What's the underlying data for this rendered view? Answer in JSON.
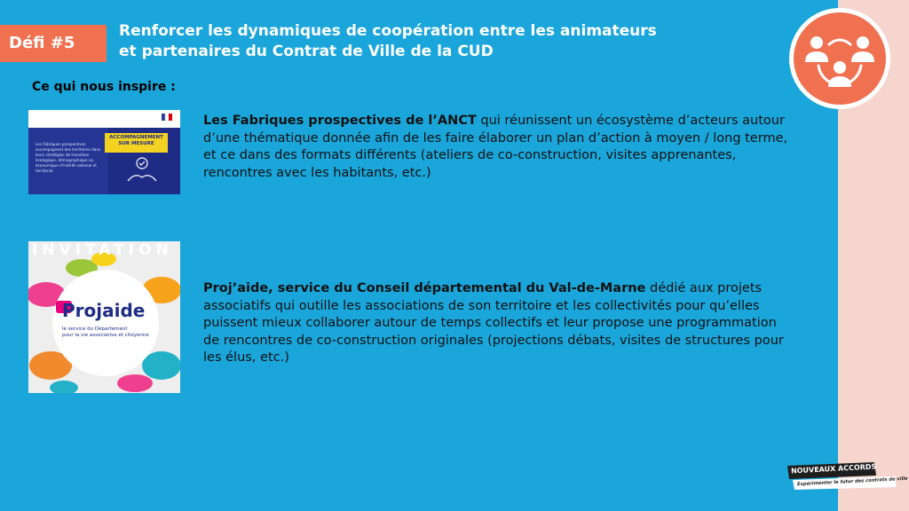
{
  "header": {
    "badge": "Défi #5",
    "title_line1": "Renforcer les dynamiques de coopération entre les animateurs",
    "title_line2": "et partenaires du Contrat de Ville de la CUD"
  },
  "section_title": "Ce qui nous inspire :",
  "items": [
    {
      "bold": "Les Fabriques prospectives de l’ANCT",
      "text": " qui réunissent un écosystème d’acteurs autour d’une thématique donnée afin de les faire élaborer un plan d’action à moyen / long terme, et ce dans des formats différents (ateliers de co-construction, visites apprenantes, rencontres avec les habitants, etc.)"
    },
    {
      "bold": "Proj’aide, service du Conseil départemental du Val-de-Marne",
      "text": " dédié aux projets associatifs qui outille les associations de son territoire et les collectivités pour qu’elles puissent mieux collaborer autour de temps collectifs et leur propose une programmation de rencontres de co-construction originales (projections débats, visites de structures pour les élus, etc.)"
    }
  ],
  "thumb1": {
    "body_text": "Les Fabriques prospectives accompagnent des territoires dans leurs stratégies de transition écologique, démographique ou économique d’intérêt national et territorial",
    "tag_line1": "ACCOMPAGNEMENT",
    "tag_line2": "SUR MESURE"
  },
  "thumb2": {
    "banner": "INVITATION",
    "brand": "Projaide",
    "caption_line1": "le service du Département",
    "caption_line2": "pour la vie associative et citoyenne"
  },
  "footer_logo": {
    "line1": "NOUVEAUX ACCORDS",
    "line2": "Expérimenter le futur des contrats de ville"
  },
  "colors": {
    "background": "#1aa6db",
    "accent": "#f0714f",
    "side_strip": "#f7d5cf"
  },
  "icons": {
    "top_right": "people-network-icon"
  }
}
